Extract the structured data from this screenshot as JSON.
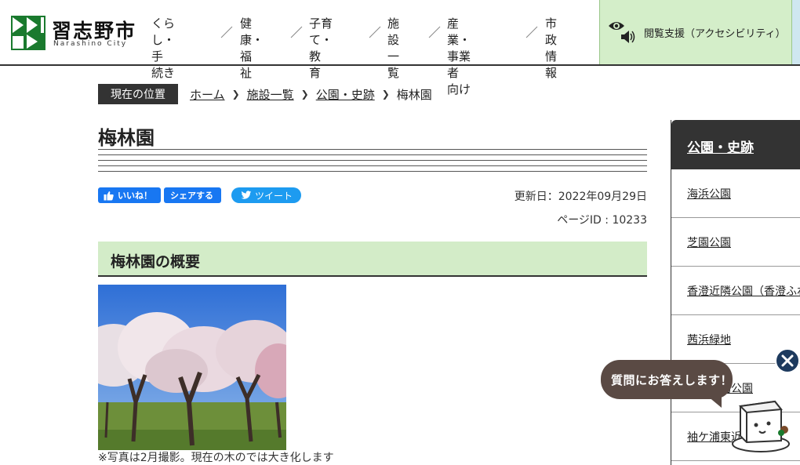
{
  "header": {
    "logo_text": "習志野市",
    "logo_sub": "Narashino City",
    "nav": [
      {
        "line1": "くらし・手",
        "line2": "続き"
      },
      {
        "line1": "健康・福",
        "line2": "祉"
      },
      {
        "line1": "子育て・教",
        "line2": "育"
      },
      {
        "line1": "施設一",
        "line2": "覧"
      },
      {
        "line1": "産業・事業者",
        "line2": "向け"
      },
      {
        "line1": "市政情",
        "line2": "報"
      }
    ],
    "accessibility_label": "閲覧支援（アクセシビリティ）"
  },
  "breadcrumb": {
    "here_label": "現在の位置",
    "links": [
      "ホーム",
      "施設一覧",
      "公園・史跡"
    ],
    "current": "梅林園"
  },
  "main": {
    "title": "梅林園",
    "sns": {
      "like": "いいね！",
      "share": "シェアする",
      "tweet": "ツイート"
    },
    "updated": "更新日：2022年09月29日",
    "page_id": "ページID : 10233",
    "section_heading": "梅林園の概要",
    "caption": "※写真は2月撮影。現在の木のでは大き化します"
  },
  "sidebar": {
    "heading": "公園・史跡",
    "items": [
      "海浜公園",
      "芝園公園",
      "香澄近隣公園（香澄ふれあい",
      "茜浜緑地",
      "秋津運動公園",
      "袖ケ浦東近隣公園"
    ]
  },
  "chatbot": {
    "bubble_text": "質問にお答えします！"
  },
  "colors": {
    "accent_green": "#d3ecc8",
    "logo_green": "#1a7a2e",
    "dark": "#333333",
    "facebook": "#1877f2",
    "twitter": "#1d9bf0",
    "chat_bubble": "#5a4a44"
  }
}
